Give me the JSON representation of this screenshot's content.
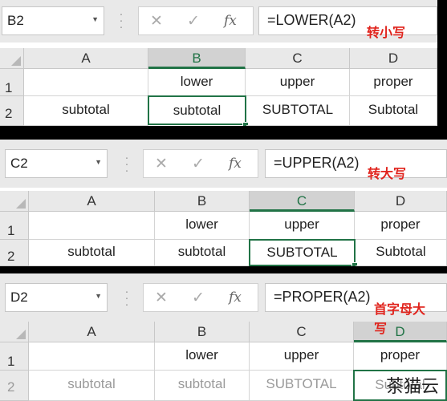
{
  "columns": [
    "A",
    "B",
    "C",
    "D"
  ],
  "rows": [
    "1",
    "2"
  ],
  "row1": [
    "",
    "lower",
    "upper",
    "proper"
  ],
  "row2": [
    "subtotal",
    "subtotal",
    "SUBTOTAL",
    "Subtotal"
  ],
  "panels": [
    {
      "name_box": "B2",
      "formula": "=LOWER(A2)",
      "note": "转小写"
    },
    {
      "name_box": "C2",
      "formula": "=UPPER(A2)",
      "note": "转大写"
    },
    {
      "name_box": "D2",
      "formula": "=PROPER(A2)",
      "note": "首字母大写"
    }
  ],
  "icons": {
    "cancel": "✕",
    "enter": "✓",
    "function": "fx"
  },
  "watermark": "茶猫云",
  "colors": {
    "selection": "#217346",
    "annotation": "#e0231c"
  }
}
